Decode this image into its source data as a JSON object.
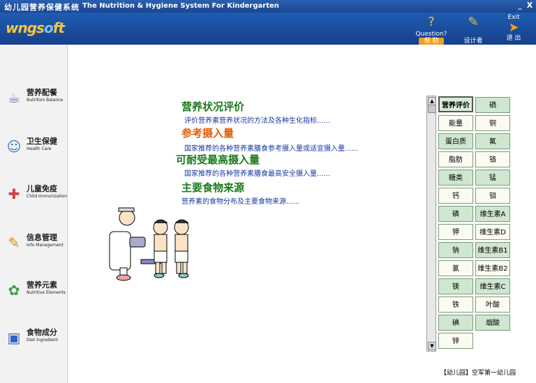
{
  "window": {
    "title_cn": "幼儿园营养保健系统",
    "title_en": "The Nutrition & Hygiene System For Kindergarten",
    "minimize": "_",
    "close": "X"
  },
  "logo": {
    "text_a": "wngs",
    "text_o": "o",
    "text_b": "ft"
  },
  "toolbar": {
    "help_top": "Question?",
    "help_label": "帮 助",
    "designer_label": "设计者",
    "exit_top": "Exit",
    "exit_label": "退 出"
  },
  "sidebar": {
    "items": [
      {
        "cn": "营养配餐",
        "en": "Nutrition Balance",
        "icon": "bowl-icon"
      },
      {
        "cn": "卫生保健",
        "en": "Health Care",
        "icon": "nurse-icon"
      },
      {
        "cn": "儿童免疫",
        "en": "Child Immunization",
        "icon": "vaccine-icon"
      },
      {
        "cn": "信息管理",
        "en": "Info Management",
        "icon": "info-icon"
      },
      {
        "cn": "营养元素",
        "en": "Nutritive Elements",
        "icon": "elements-icon"
      },
      {
        "cn": "食物成分",
        "en": "Diet Ingredient",
        "icon": "book-icon"
      }
    ]
  },
  "topics": [
    {
      "title": "营养状况评价",
      "desc": "评价营养素营养状况的方法及各种生化指标......"
    },
    {
      "title": "参考摄入量",
      "desc": "国家推荐的各种营养素膳食参考摄入量或适宜摄入量......"
    },
    {
      "title": "可耐受最高摄入量",
      "desc": "国家推荐的各种营养素膳食最高安全摄入量......"
    },
    {
      "title": "主要食物来源",
      "desc": "营养素的食物分布及主要食物来源......"
    }
  ],
  "panel": {
    "left": [
      "营养评价",
      "能量",
      "蛋白质",
      "脂肪",
      "糖类",
      "钙",
      "磷",
      "钾",
      "钠",
      "氯",
      "镁",
      "铁",
      "碘",
      "锌"
    ],
    "right": [
      "硒",
      "铜",
      "氟",
      "铬",
      "锰",
      "钼",
      "维生素A",
      "维生素D",
      "维生素B1",
      "维生素B2",
      "维生素C",
      "叶酸",
      "烟酸"
    ]
  },
  "footer": "【幼儿园】空军第一幼儿园",
  "colors": {
    "header": "#1c4690",
    "topic_green": "#1b7a1b",
    "topic_orange": "#e0600a",
    "desc_blue": "#1a3aa0"
  }
}
